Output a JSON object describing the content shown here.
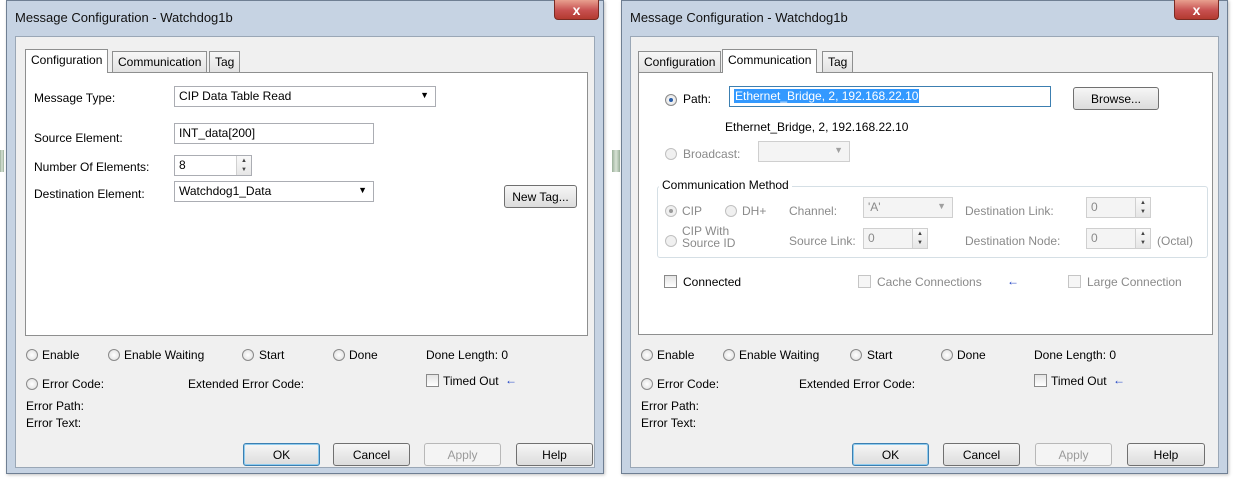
{
  "left": {
    "title": "Message Configuration - Watchdog1b",
    "close_glyph": "x",
    "tabs": [
      "Configuration",
      "Communication",
      "Tag"
    ],
    "message_type_label": "Message Type:",
    "message_type_value": "CIP Data Table Read",
    "source_element_label": "Source Element:",
    "source_element_value": "INT_data[200]",
    "num_elements_label": "Number Of Elements:",
    "num_elements_value": "8",
    "dest_element_label": "Destination Element:",
    "dest_element_value": "Watchdog1_Data",
    "new_tag_label": "New Tag...",
    "enable": "Enable",
    "enable_waiting": "Enable Waiting",
    "start": "Start",
    "done": "Done",
    "done_length": "Done Length: 0",
    "error_code": "Error Code:",
    "extended_error_code": "Extended Error Code:",
    "timed_out": "Timed Out",
    "error_path": "Error Path:",
    "error_text": "Error Text:",
    "ok": "OK",
    "cancel": "Cancel",
    "apply": "Apply",
    "help": "Help"
  },
  "right": {
    "title": "Message Configuration - Watchdog1b",
    "close_glyph": "x",
    "tabs": [
      "Configuration",
      "Communication",
      "Tag"
    ],
    "path_label": "Path:",
    "path_value": "Ethernet_Bridge, 2, 192.168.22.10",
    "path_resolved": "Ethernet_Bridge, 2, 192.168.22.10",
    "browse": "Browse...",
    "broadcast_label": "Broadcast:",
    "comm_method_caption": "Communication Method",
    "cip": "CIP",
    "dh_plus": "DH+",
    "channel_label": "Channel:",
    "channel_value": "'A'",
    "dest_link_label": "Destination Link:",
    "dest_link_value": "0",
    "cip_with_source_line1": "CIP With",
    "cip_with_source_line2": "Source ID",
    "source_link_label": "Source Link:",
    "source_link_value": "0",
    "dest_node_label": "Destination Node:",
    "dest_node_value": "0",
    "octal": "(Octal)",
    "connected": "Connected",
    "cache_connections": "Cache Connections",
    "large_connection": "Large Connection",
    "enable": "Enable",
    "enable_waiting": "Enable Waiting",
    "start": "Start",
    "done": "Done",
    "done_length": "Done Length: 0",
    "error_code": "Error Code:",
    "extended_error_code": "Extended Error Code:",
    "timed_out": "Timed Out",
    "error_path": "Error Path:",
    "error_text": "Error Text:",
    "ok": "OK",
    "cancel": "Cancel",
    "apply": "Apply",
    "help": "Help"
  },
  "icons": {
    "indicator_arrow": "←",
    "dropdown": "▼",
    "spin_up": "▲",
    "spin_down": "▼"
  },
  "colors": {
    "frame": "#c6d3e3",
    "indicator_arrow": "#1b3fc4",
    "selection": "#3399ff"
  }
}
